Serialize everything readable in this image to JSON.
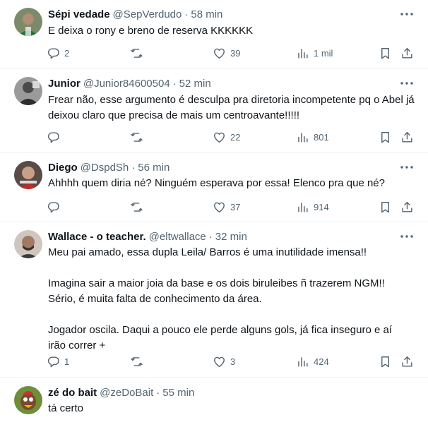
{
  "tweets": [
    {
      "name": "Sépi vedade",
      "handle": "@SepVerdudo",
      "time": "58 min",
      "text": "E deixa o rony e breno de reserva KKKKKK",
      "replies": "2",
      "retweets": "",
      "likes": "39",
      "views": "1 mil"
    },
    {
      "name": "Junior",
      "handle": "@Junior84600504",
      "time": "52 min",
      "text": "Frear não, esse argumento é desculpa pra diretoria incompetente pq o Abel já deixou claro que precisa de mais um centroavante!!!!!",
      "replies": "",
      "retweets": "",
      "likes": "22",
      "views": "801"
    },
    {
      "name": "Diego",
      "handle": "@DspdSh",
      "time": "56 min",
      "text": "Ahhhh quem diria né? Ninguém esperava por essa! Elenco pra que né?",
      "replies": "",
      "retweets": "",
      "likes": "37",
      "views": "914"
    },
    {
      "name": "Wallace - o teacher.",
      "handle": "@eltwallace",
      "time": "32 min",
      "text": "Meu pai amado, essa dupla Leila/ Barros é uma inutilidade imensa!!\n\nImagina sair a maior joia da base e os dois biruleibes ñ trazerem NGM!!\nSério, é muita falta de conhecimento da área.\n\nJogador oscila. Daqui a pouco ele perde alguns gols, já fica inseguro e aí irão correr +",
      "replies": "1",
      "retweets": "",
      "likes": "3",
      "views": "424"
    },
    {
      "name": "zé do bait",
      "handle": "@zeDoBait",
      "time": "55 min",
      "text": "tá certo"
    }
  ],
  "colors": {
    "text": "#0f1419",
    "muted": "#536471",
    "divider": "#eff3f4"
  },
  "icons": [
    "more-icon",
    "reply-icon",
    "retweet-icon",
    "like-icon",
    "views-icon",
    "bookmark-icon",
    "share-icon"
  ]
}
